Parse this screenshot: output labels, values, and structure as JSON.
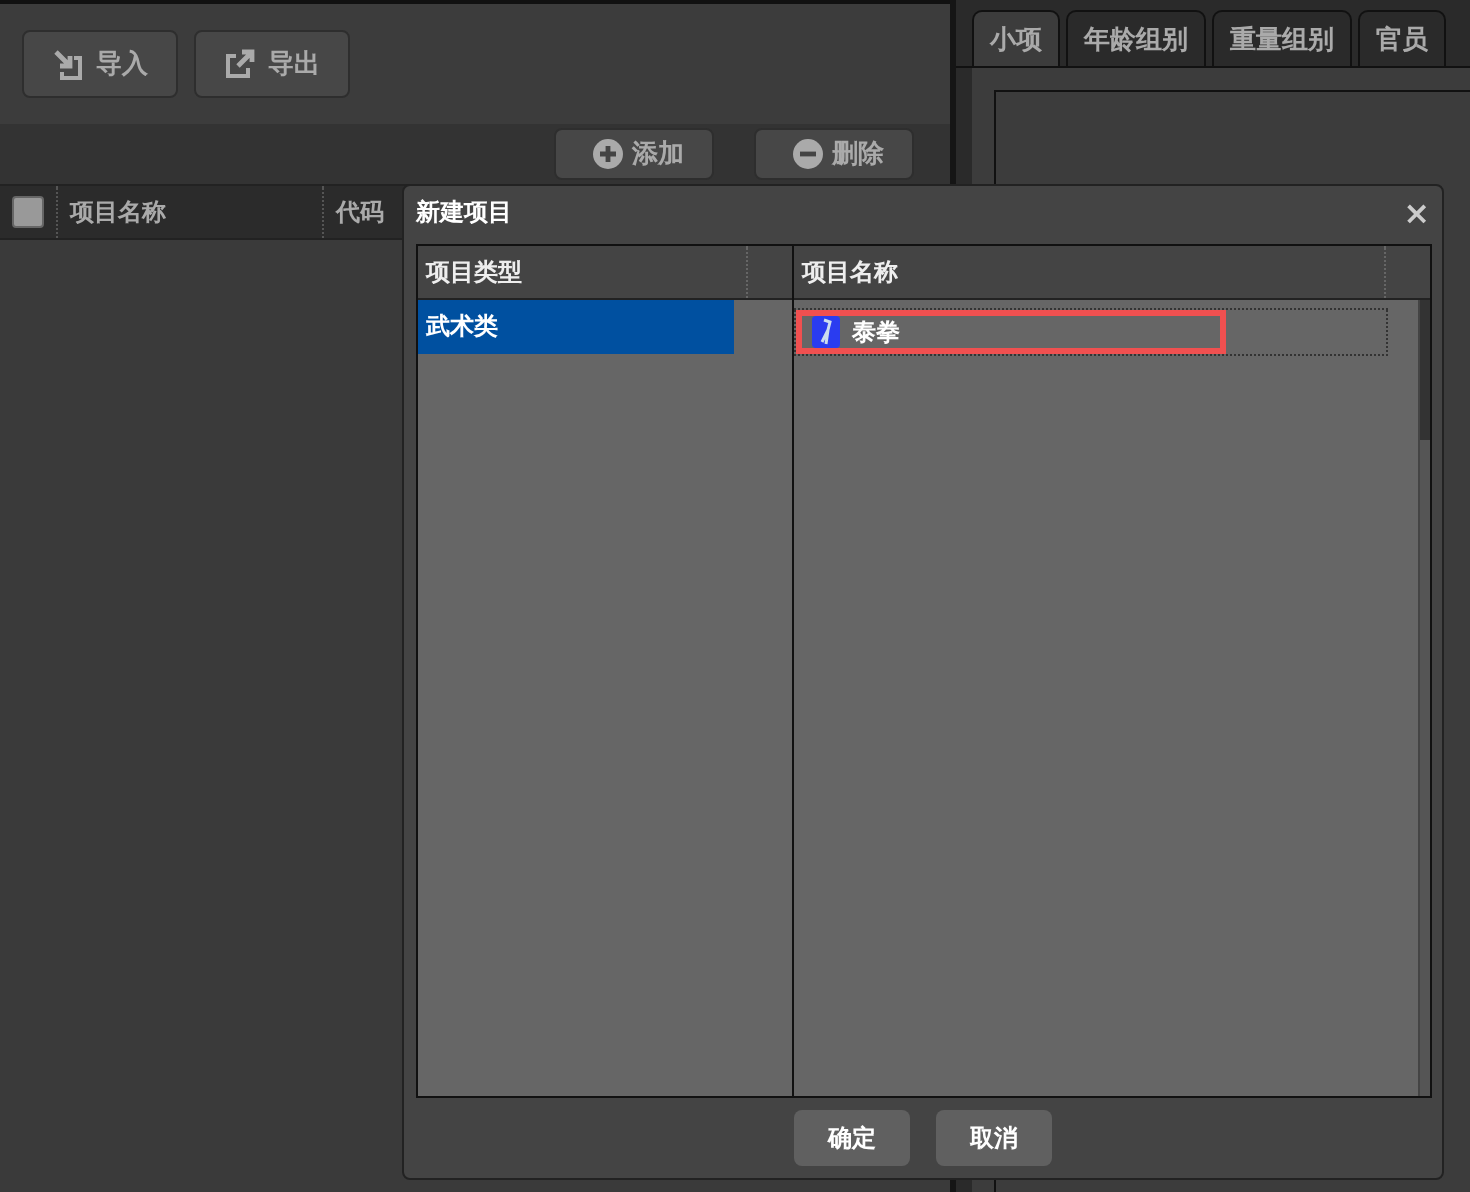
{
  "toolbar": {
    "buttons": [
      {
        "label": "导入",
        "kind": "import"
      },
      {
        "label": "导出",
        "kind": "export"
      }
    ]
  },
  "actions": [
    {
      "label": "添加",
      "kind": "add"
    },
    {
      "label": "删除",
      "kind": "remove"
    }
  ],
  "table": {
    "select_all": {
      "checked": false
    },
    "columns": [
      "项目名称",
      "代码"
    ]
  },
  "tabs": [
    {
      "label": "小项",
      "selected": true
    },
    {
      "label": "年龄组别",
      "selected": false
    },
    {
      "label": "重量组别",
      "selected": false
    },
    {
      "label": "官员",
      "selected": false
    }
  ],
  "dialog": {
    "title": "新建项目",
    "close": "×",
    "types": {
      "header": "项目类型",
      "items": [
        {
          "label": "武术类",
          "selected": true
        }
      ]
    },
    "names": {
      "header": "项目名称",
      "items": [
        {
          "label": "泰拳",
          "selected": true
        }
      ]
    },
    "buttons": [
      "确定",
      "取消"
    ]
  }
}
